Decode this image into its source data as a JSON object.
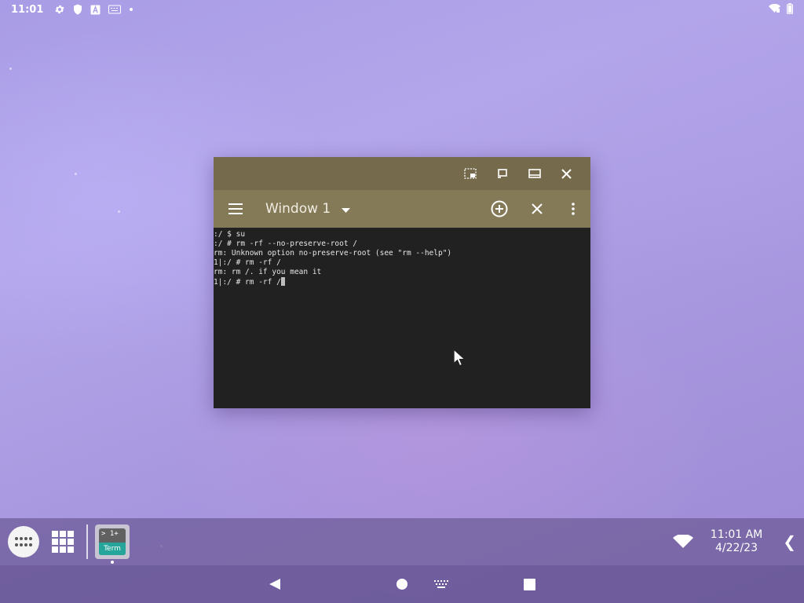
{
  "status_bar": {
    "time": "11:01",
    "icons": [
      "settings-icon",
      "shield-icon",
      "font-icon",
      "keyboard-icon",
      "dot-icon"
    ],
    "right_icons": [
      "wifi-icon",
      "battery-icon"
    ]
  },
  "window": {
    "title_bar_buttons": [
      "picture-in-picture-icon",
      "restore-icon",
      "maximize-icon",
      "close-icon"
    ],
    "toolbar": {
      "menu_icon": "hamburger-menu-icon",
      "window_name": "Window 1",
      "add_icon": "add-window-icon",
      "close_icon": "close-window-icon",
      "more_icon": "more-options-icon"
    },
    "terminal_lines": [
      ":/ $ su",
      ":/ # rm -rf --no-preserve-root /",
      "rm: Unknown option no-preserve-root (see \"rm --help\")",
      "1|:/ # rm -rf /",
      "rm: rm /. if you mean it",
      "1|:/ # rm -rf /"
    ]
  },
  "taskbar": {
    "app": {
      "top_text": "> 1+",
      "bottom_text": "Term"
    },
    "clock_time": "11:01 AM",
    "clock_date": "4/22/23",
    "expand_glyph": "❮"
  },
  "colors": {
    "titlebar": "#756a4c",
    "toolbar": "#857a58",
    "terminal_bg": "#212121",
    "term_app_accent": "#26a69a"
  }
}
